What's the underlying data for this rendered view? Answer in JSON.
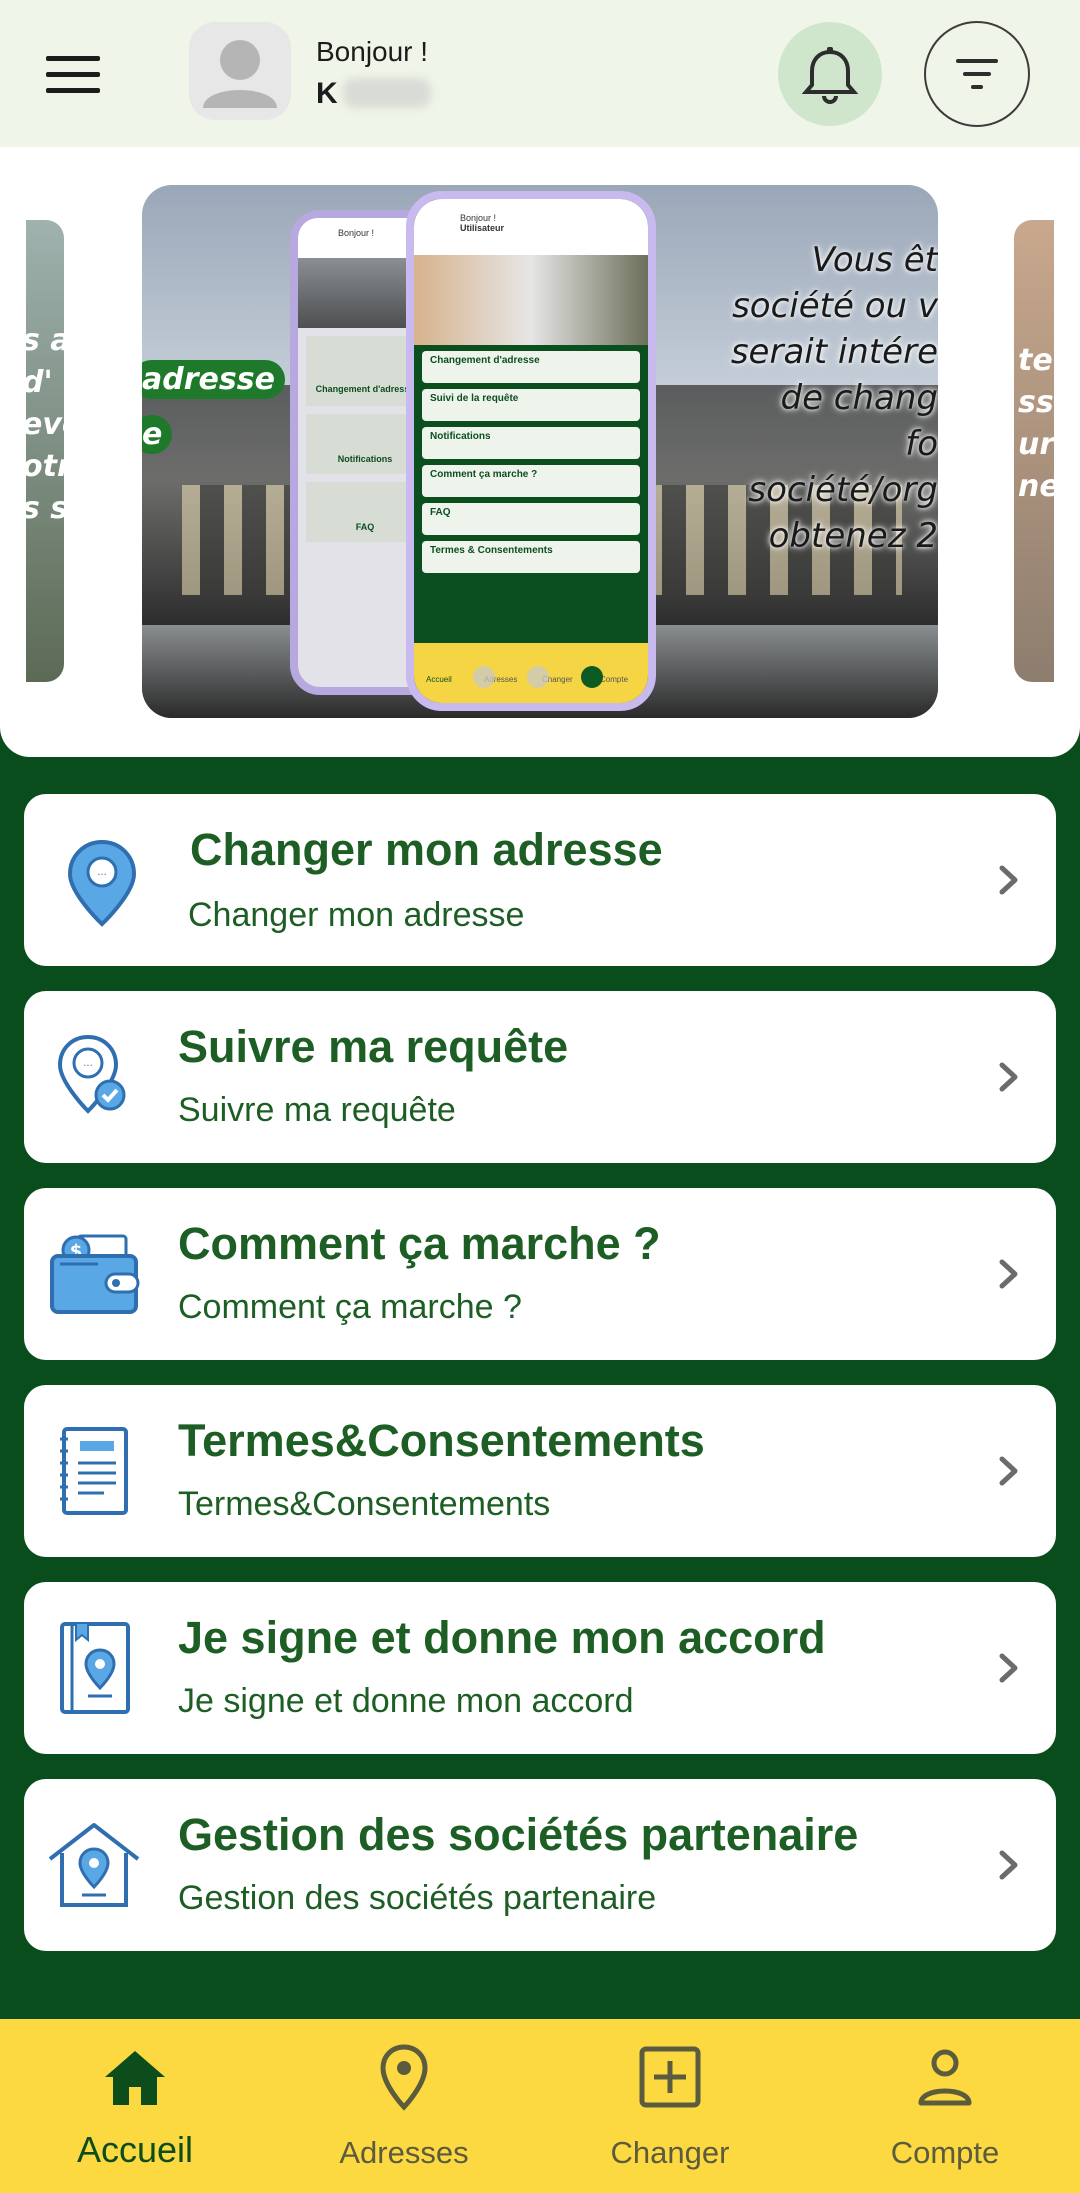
{
  "header": {
    "greeting": "Bonjour !",
    "username": "K",
    "menu_icon": "hamburger-menu-icon",
    "bell_icon": "bell-icon",
    "filter_icon": "filter-icon",
    "colors": {
      "bg": "#eff5e8",
      "bell_bg": "#cfe6cc"
    }
  },
  "carousel": {
    "main_slide_text": [
      "Vous êt",
      "société ou v",
      "serait intére",
      "de chang",
      "fo",
      "société/org",
      "obtenez 2 "
    ],
    "left_slide_tags": [
      "adresse",
      "e"
    ],
    "left_slide_text": [
      "s a",
      "d'",
      "eve",
      "otr",
      "s s"
    ],
    "right_slide_text": [
      "te",
      "sse",
      "urs",
      "nes"
    ],
    "phone_menu": [
      {
        "label": "Changement d'adresse",
        "sub": "Changement d'adresse"
      },
      {
        "label": "Suivi de la requête",
        "sub": "Suivi de la requête"
      },
      {
        "label": "Notifications",
        "sub": "Notifications"
      },
      {
        "label": "Comment ça marche ?",
        "sub": "Comment ça marche ?"
      },
      {
        "label": "FAQ",
        "sub": "FAQ"
      },
      {
        "label": "Termes & Consentements",
        "sub": "Termes & Consentements"
      }
    ],
    "phone_back_labels": [
      "Changement d'adresse",
      "Notifications",
      "FAQ"
    ],
    "phone_nav": [
      "Accueil",
      "Adresses",
      "Changer",
      "Compte"
    ],
    "phone_header": [
      "Bonjour !",
      "Utilisateur"
    ],
    "active_dot": 2,
    "dot_count": 3
  },
  "cards": [
    {
      "title": "Changer mon adresse",
      "subtitle": "Changer mon adresse",
      "icon": "location-pin-icon"
    },
    {
      "title": "Suivre ma requête",
      "subtitle": "Suivre ma requête",
      "icon": "location-check-icon"
    },
    {
      "title": "Comment ça marche ?",
      "subtitle": "Comment ça marche ?",
      "icon": "wallet-icon"
    },
    {
      "title": "Termes&Consentements",
      "subtitle": "Termes&Consentements",
      "icon": "document-notebook-icon"
    },
    {
      "title": "Je signe et donne mon accord",
      "subtitle": "Je signe et donne mon accord",
      "icon": "map-book-icon"
    },
    {
      "title": "Gestion des sociétés partenaire",
      "subtitle": "Gestion des sociétés partenaire",
      "icon": "house-location-icon"
    }
  ],
  "bottom_nav": [
    {
      "label": "Accueil",
      "icon": "home-icon",
      "active": true
    },
    {
      "label": "Adresses",
      "icon": "location-pin-icon",
      "active": false
    },
    {
      "label": "Changer",
      "icon": "plus-square-icon",
      "active": false
    },
    {
      "label": "Compte",
      "icon": "person-icon",
      "active": false
    }
  ],
  "colors": {
    "primary_green": "#0a4d1c",
    "title_green": "#1d5e24",
    "icon_blue": "#3c7fc4",
    "nav_yellow": "#fcd841"
  }
}
